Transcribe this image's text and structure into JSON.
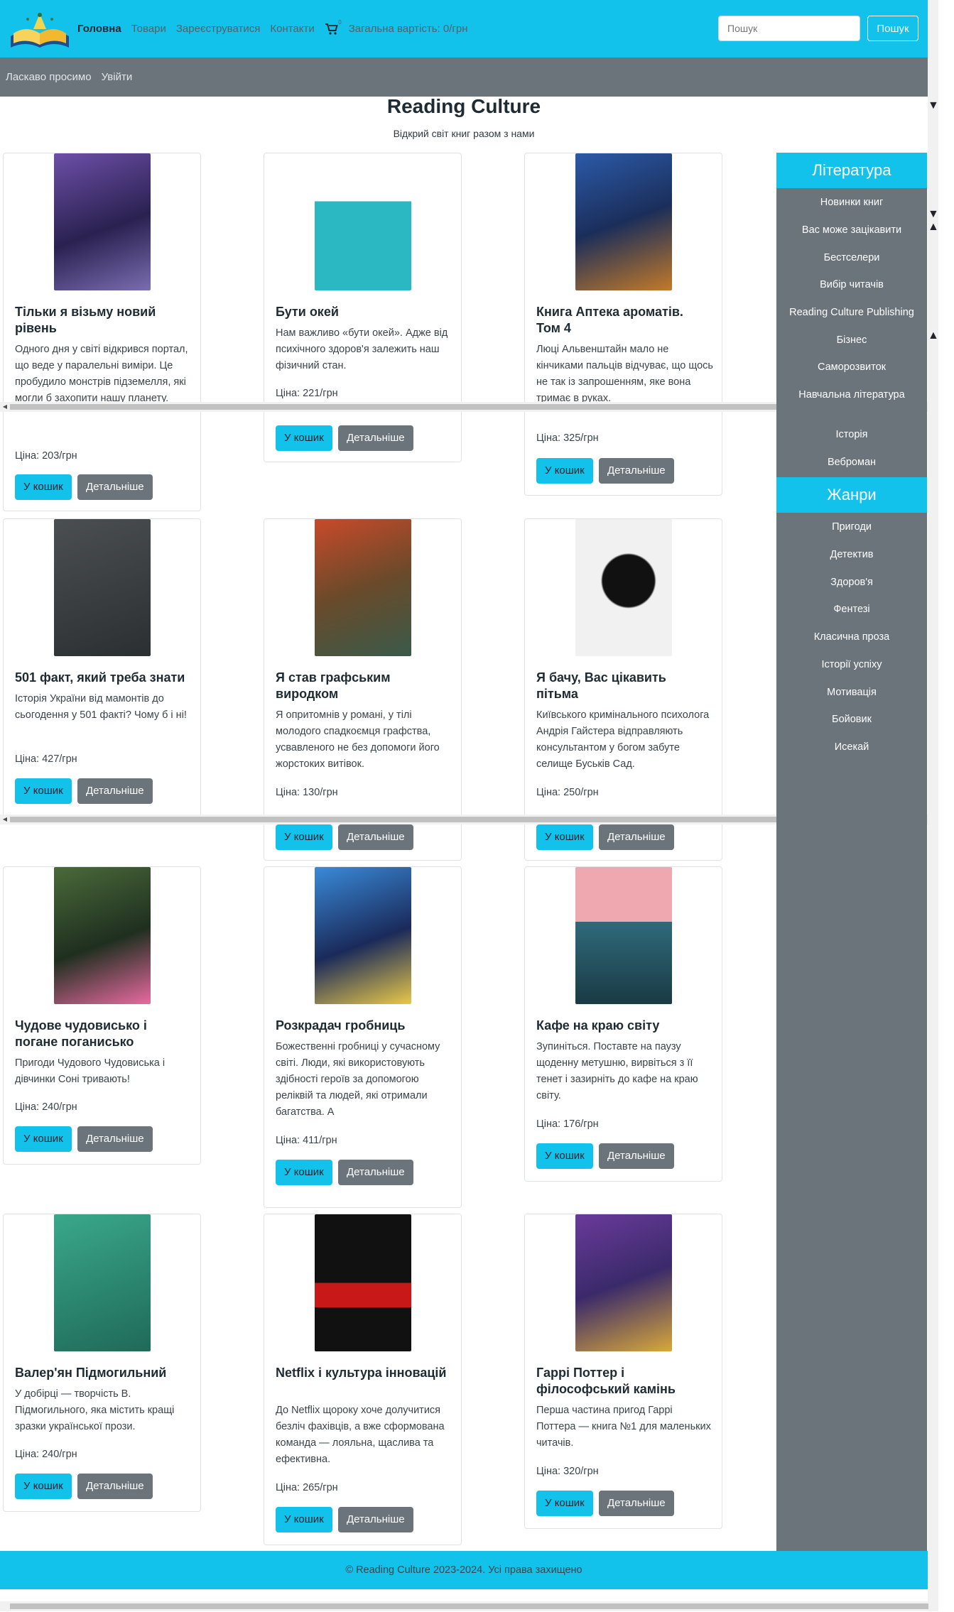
{
  "nav": {
    "home": "Головна",
    "products": "Товари",
    "register": "Зареєструватися",
    "contacts": "Контакти",
    "cart_count": "0",
    "total": "Загальна вартість: 0/грн",
    "search_placeholder": "Пошук",
    "search_button": "Пошук"
  },
  "subbar": {
    "welcome": "Ласкаво просимо",
    "login": "Увійти"
  },
  "hero": {
    "title": "Reading Culture",
    "subtitle": "Відкрий світ книг разом з нами"
  },
  "buttons": {
    "cart": "У кошик",
    "details": "Детальніше"
  },
  "products": [
    {
      "title": "Тільки я візьму новий рівень",
      "desc": "Одного дня у світі відкрився портал, що веде у паралельні виміри. Це пробудило монстрів підземелля, які могли б захопити нашу планету.",
      "price": "Ціна: 203/грн",
      "cover": "#3a2f63"
    },
    {
      "title": "Бути окей",
      "desc": "Нам важливо «бути окей». Адже від психічного здоров'я залежить наш фізичний стан.",
      "price": "Ціна: 221/грн",
      "cover": "#2cb8c2"
    },
    {
      "title": "Книга Аптека ароматів. Том 4",
      "desc": "Люці Альвенштайн мало не кінчиками пальців відчуває, що щось не так із запрошенням, яке вона тримає в руках.",
      "price": "Ціна: 325/грн",
      "cover": "#1d3a6e"
    },
    {
      "title": "501 факт, який треба знати",
      "desc": "Історія України від мамонтів до сьогодення у 501 факті? Чому б і ні!",
      "price": "Ціна: 427/грн",
      "cover": "#3b3f42"
    },
    {
      "title": "Я став графським виродком",
      "desc": "Я опритомнів у романі, у тілі молодого спадкоємця графства, усвавленого не без допомоги його жорстоких витівок.",
      "price": "Ціна: 130/грн",
      "cover": "#7a5a2e"
    },
    {
      "title": "Я бачу, Вас цікавить пітьма",
      "desc": "Київського кримінального психолога Андрія Гайстера відправляють консультантом у богом забуте селище Буськів Сад.",
      "price": "Ціна: 250/грн",
      "cover": "#efefef"
    },
    {
      "title": "Чудове чудовисько і погане поганисько",
      "desc": "Пригоди Чудового Чудовиська і дівчинки Соні тривають!",
      "price": "Ціна: 240/грн",
      "cover": "#2c3a2a"
    },
    {
      "title": "Розкрадач гробниць",
      "desc": "Божественні гробниці у сучасному світі. Люди, які використовують здібності героїв за допомогою реліквій та людей, які отримали багатства. А",
      "price": "Ціна: 411/грн",
      "cover": "#1e3f7a"
    },
    {
      "title": "Кафе на краю світу",
      "desc": "Зупиніться. Поставте на паузу щоденну метушню, вирвіться з її тенет і зазирніть до кафе на краю світу.",
      "price": "Ціна: 176/грн",
      "cover": "#2f5f6f"
    },
    {
      "title": "Валер'ян Підмогильний",
      "desc": "У добірці — творчість В. Підмогильного, яка містить кращі зразки української прози.",
      "price": "Ціна: 240/грн",
      "cover": "#2a8a74"
    },
    {
      "title": "Netflix і культура інновацій",
      "desc": "До Netflix щороку хоче долучитися безліч фахівців, а вже сформована команда — лояльна, щаслива та ефективна.",
      "price": "Ціна: 265/грн",
      "cover": "#111111"
    },
    {
      "title": "Гаррі Поттер і філософський камінь",
      "desc": "Перша частина пригод Гаррі Поттера — книга №1 для маленьких читачів.",
      "price": "Ціна: 320/грн",
      "cover": "#5a3a7a"
    }
  ],
  "sidebar": {
    "literature_title": "Література",
    "literature": [
      "Новинки книг",
      "Вас може зацікавити",
      "Бестселери",
      "Вибір читачів",
      "Reading Culture Publishing",
      "Бізнес",
      "Саморозвиток",
      "Навчальна література",
      "Історія",
      "Веброман"
    ],
    "genres_title": "Жанри",
    "genres": [
      "Пригоди",
      "Детектив",
      "Здоров'я",
      "Фентезі",
      "Класична проза",
      "Історії успіху",
      "Мотивація",
      "Бойовик",
      "Исекай"
    ]
  },
  "footer": "© Reading Culture 2023-2024. Усі права захищено",
  "colors": {
    "accent": "#13c2ea",
    "secondary": "#6b737b"
  }
}
